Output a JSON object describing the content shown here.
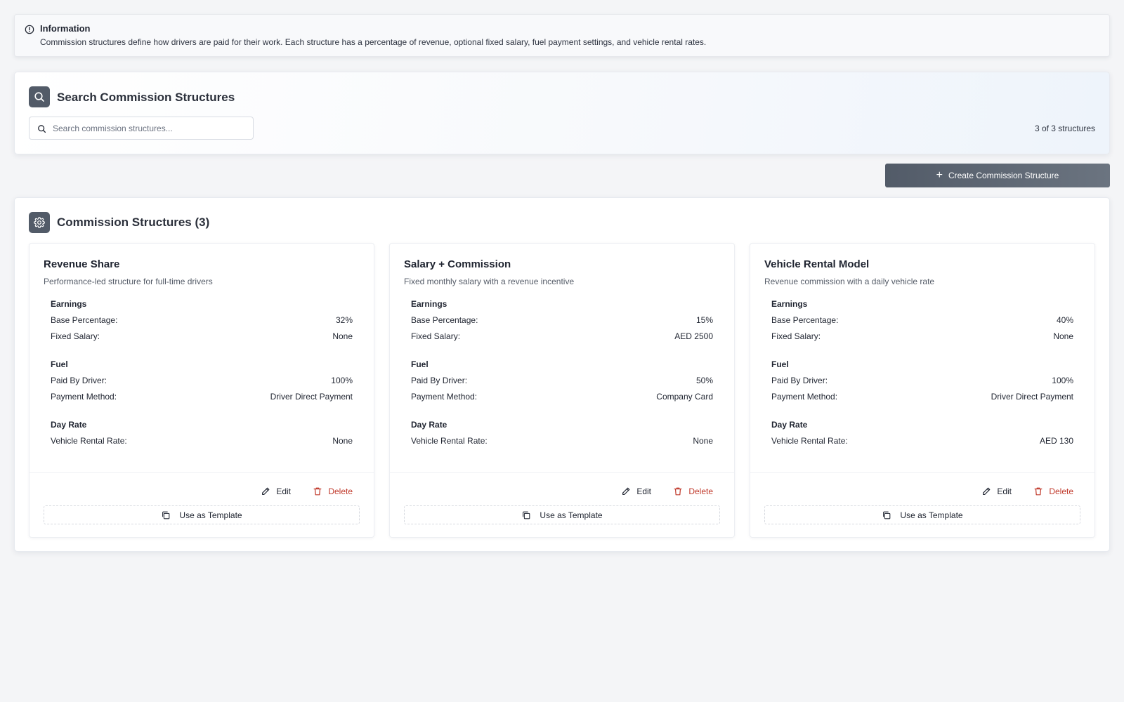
{
  "info": {
    "title": "Information",
    "text": "Commission structures define how drivers are paid for their work. Each structure has a percentage of revenue, optional fixed salary, fuel payment settings, and vehicle rental rates."
  },
  "search": {
    "title": "Search Commission Structures",
    "placeholder": "Search commission structures...",
    "value": "",
    "count_text": "3 of 3 structures"
  },
  "create_button": {
    "label": "Create Commission Structure"
  },
  "structures": {
    "title": "Commission Structures (3)",
    "items": [
      {
        "name": "Revenue Share",
        "description": "Performance-led structure for full-time drivers",
        "earnings_title": "Earnings",
        "base_percentage_label": "Base Percentage:",
        "base_percentage": "32%",
        "fixed_salary_label": "Fixed Salary:",
        "fixed_salary": "None",
        "fuel_title": "Fuel",
        "paid_by_driver_label": "Paid By Driver:",
        "paid_by_driver": "100%",
        "payment_method_label": "Payment Method:",
        "payment_method": "Driver Direct Payment",
        "day_rate_title": "Day Rate",
        "vehicle_rental_label": "Vehicle Rental Rate:",
        "vehicle_rental": "None",
        "edit_label": "Edit",
        "delete_label": "Delete",
        "template_label": "Use as Template"
      },
      {
        "name": "Salary + Commission",
        "description": "Fixed monthly salary with a revenue incentive",
        "earnings_title": "Earnings",
        "base_percentage_label": "Base Percentage:",
        "base_percentage": "15%",
        "fixed_salary_label": "Fixed Salary:",
        "fixed_salary": "AED 2500",
        "fuel_title": "Fuel",
        "paid_by_driver_label": "Paid By Driver:",
        "paid_by_driver": "50%",
        "payment_method_label": "Payment Method:",
        "payment_method": "Company Card",
        "day_rate_title": "Day Rate",
        "vehicle_rental_label": "Vehicle Rental Rate:",
        "vehicle_rental": "None",
        "edit_label": "Edit",
        "delete_label": "Delete",
        "template_label": "Use as Template"
      },
      {
        "name": "Vehicle Rental Model",
        "description": "Revenue commission with a daily vehicle rate",
        "earnings_title": "Earnings",
        "base_percentage_label": "Base Percentage:",
        "base_percentage": "40%",
        "fixed_salary_label": "Fixed Salary:",
        "fixed_salary": "None",
        "fuel_title": "Fuel",
        "paid_by_driver_label": "Paid By Driver:",
        "paid_by_driver": "100%",
        "payment_method_label": "Payment Method:",
        "payment_method": "Driver Direct Payment",
        "day_rate_title": "Day Rate",
        "vehicle_rental_label": "Vehicle Rental Rate:",
        "vehicle_rental": "AED 130",
        "edit_label": "Edit",
        "delete_label": "Delete",
        "template_label": "Use as Template"
      }
    ]
  },
  "icons": {
    "info": "info-circle-icon",
    "search": "search-icon",
    "settings": "gear-icon",
    "plus": "plus-icon",
    "edit": "pencil-icon",
    "delete": "trash-icon",
    "template": "copy-icon"
  },
  "colors": {
    "accent": "#525b68",
    "danger": "#c0392b",
    "background": "#f4f5f7"
  }
}
